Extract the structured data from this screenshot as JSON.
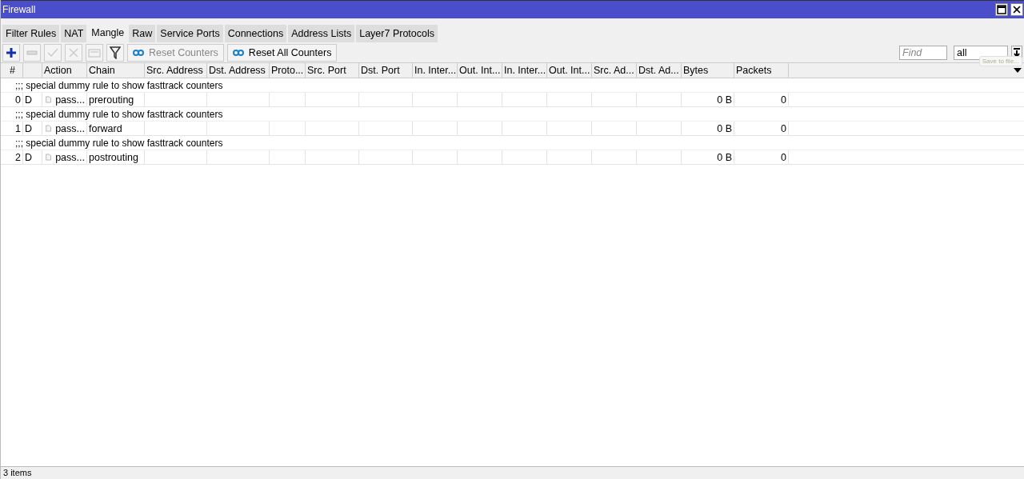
{
  "window": {
    "title": "Firewall"
  },
  "tabs": [
    {
      "label": "Filter Rules",
      "selected": false
    },
    {
      "label": "NAT",
      "selected": false
    },
    {
      "label": "Mangle",
      "selected": true
    },
    {
      "label": "Raw",
      "selected": false
    },
    {
      "label": "Service Ports",
      "selected": false
    },
    {
      "label": "Connections",
      "selected": false
    },
    {
      "label": "Address Lists",
      "selected": false
    },
    {
      "label": "Layer7 Protocols",
      "selected": false
    }
  ],
  "toolbar": [
    {
      "kind": "add",
      "disabled": false
    },
    {
      "kind": "remove",
      "disabled": true
    },
    {
      "kind": "enable",
      "disabled": true
    },
    {
      "kind": "disable",
      "disabled": true
    },
    {
      "kind": "comment",
      "disabled": true
    },
    {
      "kind": "filter",
      "disabled": false
    },
    {
      "kind": "reset",
      "label": "Reset Counters",
      "disabled": true
    },
    {
      "kind": "reset",
      "label": "Reset All Counters",
      "disabled": false
    }
  ],
  "search": {
    "placeholder": "Find",
    "scope": "all"
  },
  "tooltip": "Save to file...",
  "table": {
    "columns": [
      "#",
      "",
      "Action",
      "Chain",
      "Src. Address",
      "Dst. Address",
      "Proto...",
      "Src. Port",
      "Dst. Port",
      "In. Inter...",
      "Out. Int...",
      "In. Inter...",
      "Out. Int...",
      "Src. Ad...",
      "Dst. Ad...",
      "Bytes",
      "Packets"
    ],
    "rows": [
      {
        "kind": "comment",
        "text": ";;; special dummy rule to show fasttrack counters"
      },
      {
        "kind": "rule",
        "number": "0",
        "flag": "D",
        "action": "pass...",
        "chain": "prerouting",
        "bytes": "0 B",
        "packets": "0"
      },
      {
        "kind": "comment",
        "text": ";;; special dummy rule to show fasttrack counters"
      },
      {
        "kind": "rule",
        "number": "1",
        "flag": "D",
        "action": "pass...",
        "chain": "forward",
        "bytes": "0 B",
        "packets": "0"
      },
      {
        "kind": "comment",
        "text": ";;; special dummy rule to show fasttrack counters"
      },
      {
        "kind": "rule",
        "number": "2",
        "flag": "D",
        "action": "pass...",
        "chain": "postrouting",
        "bytes": "0 B",
        "packets": "0"
      }
    ]
  },
  "status_bar": "3 items"
}
